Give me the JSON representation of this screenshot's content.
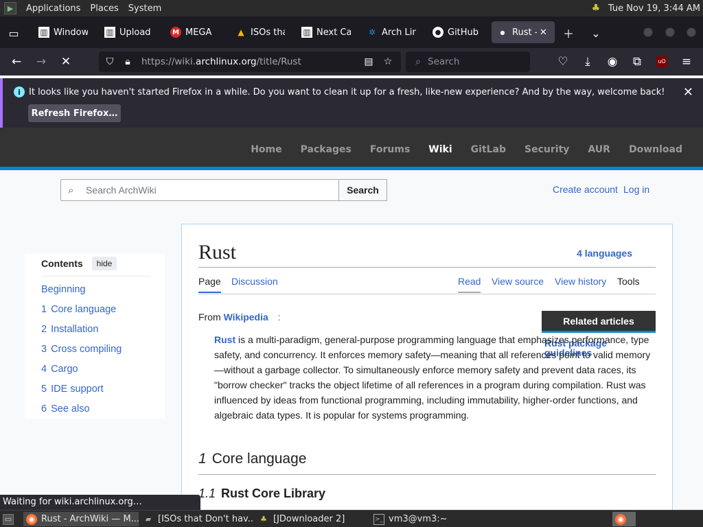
{
  "system_panel": {
    "menus": [
      "Applications",
      "Places",
      "System"
    ],
    "clock": "Tue Nov 19,  3:44 AM"
  },
  "tabs": [
    {
      "label": "Window",
      "icon": "archwiki-icon"
    },
    {
      "label": "Upload",
      "icon": "archwiki-icon"
    },
    {
      "label": "MEGA",
      "icon": "mega-icon"
    },
    {
      "label": "ISOs tha",
      "icon": "google-drive-icon"
    },
    {
      "label": "Next Ca",
      "icon": "archwiki-icon"
    },
    {
      "label": "Arch Lin",
      "icon": "arch-icon"
    },
    {
      "label": "GitHub",
      "icon": "github-icon"
    },
    {
      "label": "Rust -",
      "icon": "loading-dot-icon"
    }
  ],
  "navbar": {
    "url_prefix": "https://wiki.",
    "url_domain": "archlinux.org",
    "url_path": "/title/Rust",
    "search_placeholder": "Search"
  },
  "notification": {
    "message": "It looks like you haven't started Firefox in a while. Do you want to clean it up for a fresh, like-new experience? And by the way, welcome back!",
    "button": "Refresh Firefox…"
  },
  "arch_nav": [
    "Home",
    "Packages",
    "Forums",
    "Wiki",
    "GitLab",
    "Security",
    "AUR",
    "Download"
  ],
  "wiki_top": {
    "search_placeholder": "Search ArchWiki",
    "search_button": "Search",
    "create_account": "Create account",
    "login": "Log in"
  },
  "toc": {
    "heading": "Contents",
    "hide": "hide",
    "items": [
      {
        "num": "",
        "label": "Beginning"
      },
      {
        "num": "1",
        "label": "Core language"
      },
      {
        "num": "2",
        "label": "Installation"
      },
      {
        "num": "3",
        "label": "Cross compiling"
      },
      {
        "num": "4",
        "label": "Cargo"
      },
      {
        "num": "5",
        "label": "IDE support"
      },
      {
        "num": "6",
        "label": "See also"
      }
    ]
  },
  "article": {
    "title": "Rust",
    "languages": "4 languages",
    "tabs_left": [
      "Page",
      "Discussion"
    ],
    "tabs_right": [
      "Read",
      "View source",
      "View history",
      "Tools"
    ],
    "from_prefix": "From ",
    "from_link": "Wikipedia",
    "from_suffix": ":",
    "lead_link": "Rust",
    "lead_text": " is a multi-paradigm, general-purpose programming language that emphasizes performance, type safety, and concurrency. It enforces memory safety—meaning that all references point to valid memory—without a garbage collector. To simultaneously enforce memory safety and prevent data races, its \"borrow checker\" tracks the object lifetime of all references in a program during compilation. Rust was influenced by ideas from functional programming, including immutability, higher-order functions, and algebraic data types. It is popular for systems programming.",
    "related_heading": "Related articles",
    "related_link": "Rust package guidelines",
    "h1_num": "1",
    "h1": "Core language",
    "h2_num": "1.1",
    "h2": "Rust Core Library"
  },
  "status_text": "Waiting for wiki.archlinux.org…",
  "taskbar": [
    {
      "label": "Rust - ArchWiki — M...",
      "icon": "firefox-icon"
    },
    {
      "label": "[ISOs that Don't hav...",
      "icon": "folder-icon"
    },
    {
      "label": "[JDownloader 2]",
      "icon": "jdownloader-icon"
    },
    {
      "label": "vm3@vm3:~",
      "icon": "terminal-icon"
    }
  ]
}
